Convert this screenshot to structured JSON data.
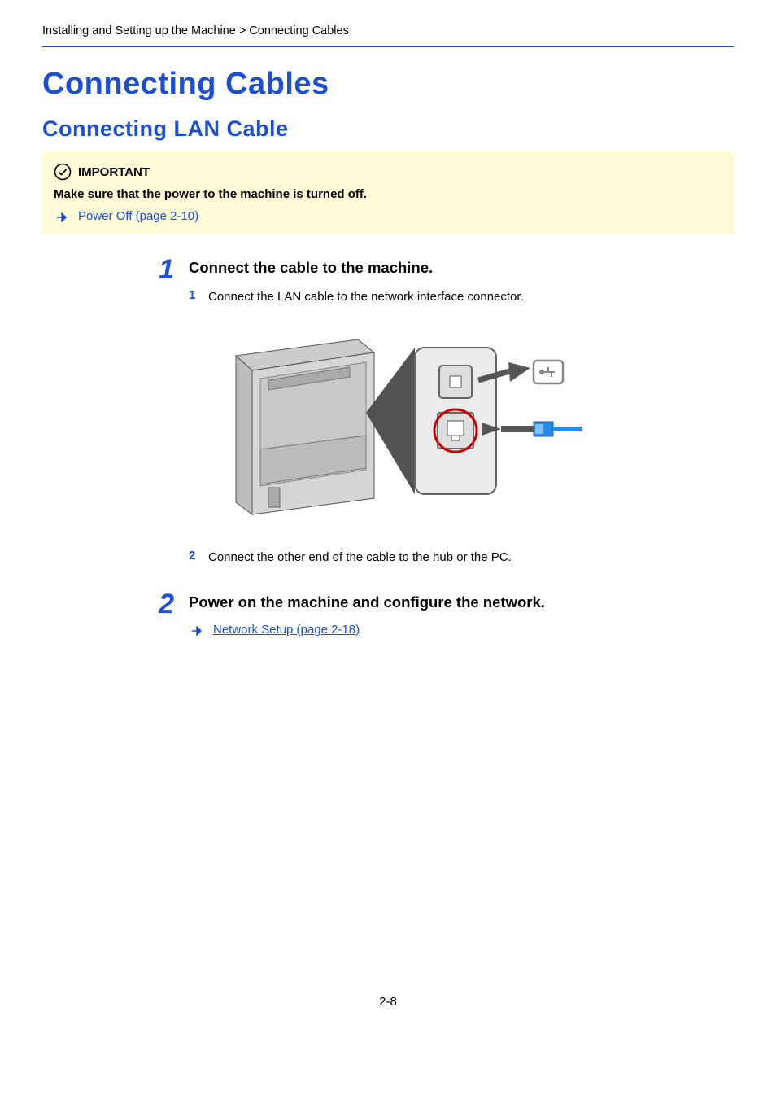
{
  "breadcrumb": "Installing and Setting up the Machine > Connecting Cables",
  "h1": "Connecting Cables",
  "h2": "Connecting LAN Cable",
  "callout": {
    "label": "IMPORTANT",
    "text": "Make sure that the power to the machine is turned off.",
    "link": "Power Off (page 2-10)"
  },
  "steps": [
    {
      "num": "1",
      "title": "Connect the cable to the machine.",
      "subs": [
        {
          "num": "1",
          "text": "Connect the LAN cable to the network interface connector."
        },
        {
          "num": "2",
          "text": "Connect the other end of the cable to the hub or the PC."
        }
      ]
    },
    {
      "num": "2",
      "title": "Power on the machine and configure the network.",
      "link": "Network Setup (page 2-18)"
    }
  ],
  "page_number": "2-8"
}
